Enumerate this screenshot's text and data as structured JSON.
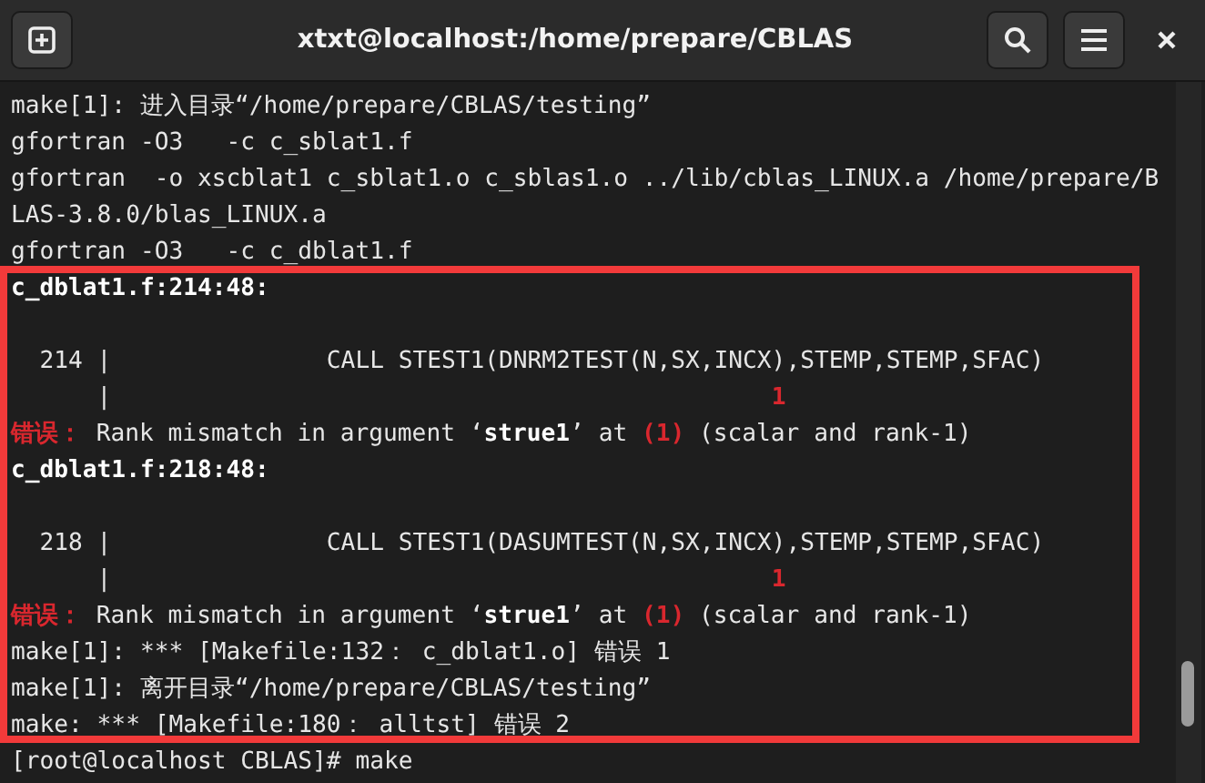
{
  "window": {
    "title": "xtxt@localhost:/home/prepare/CBLAS"
  },
  "terminal": {
    "lines": [
      {
        "kind": "text",
        "segments": [
          {
            "kind": "text",
            "text": "make[1]: 进入目录“/home/prepare/CBLAS/testing”"
          }
        ]
      },
      {
        "kind": "text",
        "segments": [
          {
            "kind": "text",
            "text": "gfortran -O3   -c c_sblat1.f"
          }
        ]
      },
      {
        "kind": "text",
        "segments": [
          {
            "kind": "text",
            "text": "gfortran  -o xscblat1 c_sblat1.o c_sblas1.o ../lib/cblas_LINUX.a /home/prepare/B"
          }
        ]
      },
      {
        "kind": "text",
        "segments": [
          {
            "kind": "text",
            "text": "LAS-3.8.0/blas_LINUX.a"
          }
        ]
      },
      {
        "kind": "text",
        "segments": [
          {
            "kind": "text",
            "text": "gfortran -O3   -c c_dblat1.f"
          }
        ]
      },
      {
        "kind": "text",
        "segments": [
          {
            "kind": "bold",
            "text": "c_dblat1.f:214:48:"
          }
        ]
      },
      {
        "kind": "blank"
      },
      {
        "kind": "text",
        "segments": [
          {
            "kind": "text",
            "text": "  214 |               CALL STEST1(DNRM2TEST(N,SX,INCX),STEMP,STEMP,SFAC)"
          }
        ]
      },
      {
        "kind": "text",
        "segments": [
          {
            "kind": "text",
            "text": "      |                                              "
          },
          {
            "kind": "error",
            "text": "1"
          }
        ]
      },
      {
        "kind": "text",
        "segments": [
          {
            "kind": "error",
            "text": "错误："
          },
          {
            "kind": "text",
            "text": " Rank mismatch in argument ‘"
          },
          {
            "kind": "bold",
            "text": "strue1"
          },
          {
            "kind": "text",
            "text": "’ at "
          },
          {
            "kind": "error",
            "text": "(1)"
          },
          {
            "kind": "text",
            "text": " (scalar and rank-1)"
          }
        ]
      },
      {
        "kind": "text",
        "segments": [
          {
            "kind": "bold",
            "text": "c_dblat1.f:218:48:"
          }
        ]
      },
      {
        "kind": "blank"
      },
      {
        "kind": "text",
        "segments": [
          {
            "kind": "text",
            "text": "  218 |               CALL STEST1(DASUMTEST(N,SX,INCX),STEMP,STEMP,SFAC)"
          }
        ]
      },
      {
        "kind": "text",
        "segments": [
          {
            "kind": "text",
            "text": "      |                                              "
          },
          {
            "kind": "error",
            "text": "1"
          }
        ]
      },
      {
        "kind": "text",
        "segments": [
          {
            "kind": "error",
            "text": "错误："
          },
          {
            "kind": "text",
            "text": " Rank mismatch in argument ‘"
          },
          {
            "kind": "bold",
            "text": "strue1"
          },
          {
            "kind": "text",
            "text": "’ at "
          },
          {
            "kind": "error",
            "text": "(1)"
          },
          {
            "kind": "text",
            "text": " (scalar and rank-1)"
          }
        ]
      },
      {
        "kind": "text",
        "segments": [
          {
            "kind": "text",
            "text": "make[1]: *** [Makefile:132： c_dblat1.o] 错误 1"
          }
        ]
      },
      {
        "kind": "text",
        "segments": [
          {
            "kind": "text",
            "text": "make[1]: 离开目录“/home/prepare/CBLAS/testing”"
          }
        ]
      },
      {
        "kind": "text",
        "segments": [
          {
            "kind": "text",
            "text": "make: *** [Makefile:180： alltst] 错误 2"
          }
        ]
      },
      {
        "kind": "text",
        "segments": [
          {
            "kind": "text",
            "text": "[root@localhost CBLAS]# make"
          }
        ]
      }
    ]
  }
}
